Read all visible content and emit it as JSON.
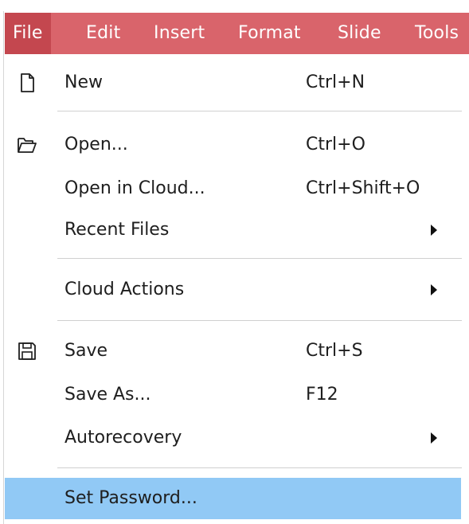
{
  "menubar": {
    "items": [
      {
        "label": "File"
      },
      {
        "label": "Edit"
      },
      {
        "label": "Insert"
      },
      {
        "label": "Format"
      },
      {
        "label": "Slide"
      },
      {
        "label": "Tools"
      }
    ]
  },
  "file_menu": {
    "items": [
      {
        "label": "New",
        "shortcut": "Ctrl+N",
        "icon": "new-document-icon"
      },
      {
        "label": "Open...",
        "shortcut": "Ctrl+O",
        "icon": "open-folder-icon"
      },
      {
        "label": "Open in Cloud...",
        "shortcut": "Ctrl+Shift+O"
      },
      {
        "label": "Recent Files",
        "submenu": true
      },
      {
        "label": "Cloud Actions",
        "submenu": true
      },
      {
        "label": "Save",
        "shortcut": "Ctrl+S",
        "icon": "save-icon"
      },
      {
        "label": "Save As...",
        "shortcut": "F12"
      },
      {
        "label": "Autorecovery",
        "submenu": true
      },
      {
        "label": "Set Password...",
        "highlighted": true
      }
    ]
  },
  "colors": {
    "menubar_bg": "#d9646b",
    "menubar_active": "#c4474f",
    "highlight": "#91c9f5"
  }
}
